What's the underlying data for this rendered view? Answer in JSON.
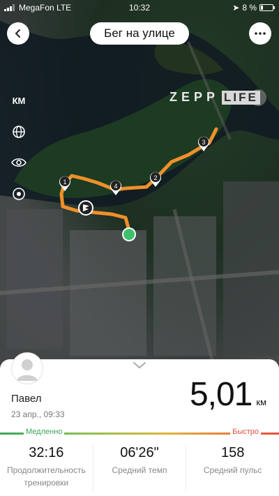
{
  "status_bar": {
    "carrier": "MegaFon  LTE",
    "time": "10:32",
    "battery": "8 %"
  },
  "header": {
    "title": "Бег на улице"
  },
  "map": {
    "unit_label": "КМ",
    "logo": "ZEPP",
    "logo_suffix": "LIFE",
    "markers": [
      "1",
      "2",
      "3",
      "4"
    ]
  },
  "summary": {
    "user_name": "Павел",
    "date": "23 апр., 09:33",
    "distance": "5,01",
    "distance_unit": "км",
    "speed_slow": "Медленно",
    "speed_fast": "Быстро"
  },
  "stats": [
    {
      "value": "32:16",
      "label": "Продолжительность тренировки"
    },
    {
      "value": "06'26\"",
      "label": "Средний темп"
    },
    {
      "value": "158",
      "label": "Средний пульс"
    }
  ],
  "colors": {
    "route": "#f0902a",
    "finish": "#3fbf6e",
    "slow": "#3aa55a",
    "fast": "#e24f3d"
  }
}
